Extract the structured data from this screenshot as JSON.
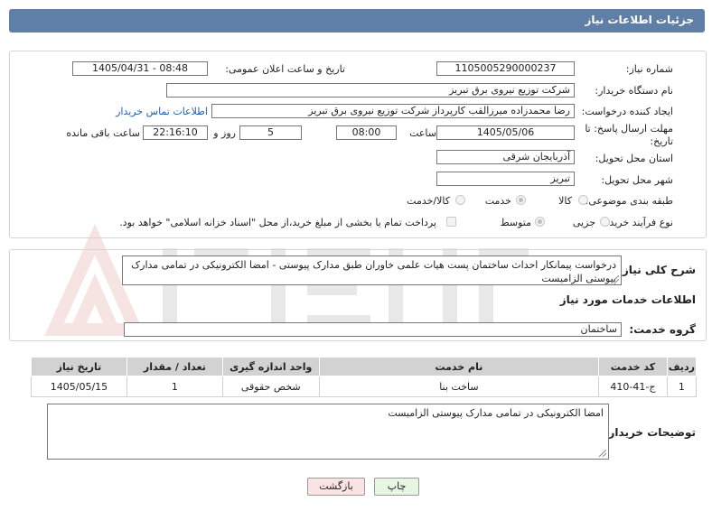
{
  "header": {
    "title": "جزئیات اطلاعات نیاز"
  },
  "need_number": {
    "label": "شماره نیاز:",
    "value": "1105005290000237"
  },
  "announce_datetime": {
    "label": "تاریخ و ساعت اعلان عمومی:",
    "value": "1405/04/31 - 08:48"
  },
  "buyer_org": {
    "label": "نام دستگاه خریدار:",
    "value": "شرکت توزیع نیروی برق تبریز"
  },
  "creator": {
    "label": "ایجاد کننده درخواست:",
    "value": "رضا محمدزاده میرزالقب کارپرداز شرکت توزیع نیروی برق تبریز",
    "contact_link": "اطلاعات تماس خریدار"
  },
  "deadline": {
    "label_line1": "مهلت ارسال پاسخ: تا",
    "label_line2": "تاریخ:",
    "date": "1405/05/06",
    "time_label": "ساعت",
    "time": "08:00",
    "days": "5",
    "days_label": "روز و",
    "remaining_time": "22:16:10",
    "remaining_label": "ساعت باقی مانده"
  },
  "province": {
    "label": "استان محل تحویل:",
    "value": "آذربایجان شرقی"
  },
  "city": {
    "label": "شهر محل تحویل:",
    "value": "تبریز"
  },
  "category": {
    "label": "طبقه بندی موضوعی:",
    "options": [
      "کالا",
      "خدمت",
      "کالا/خدمت"
    ],
    "selected": "خدمت"
  },
  "purchase_type": {
    "label": "نوع فرآیند خرید :",
    "options": [
      "جزیی",
      "متوسط"
    ],
    "selected": "متوسط",
    "payment_note": "پرداخت تمام یا بخشی از مبلغ خرید،از محل \"اسناد خزانه اسلامی\" خواهد بود."
  },
  "description": {
    "label": "شرح کلی نیاز:",
    "value": "درخواست پیمانکار احداث ساختمان پست هیات علمی خاوران طبق مدارک پیوستی - امضا الکترونیکی در تمامی مدارک پیوستی الزامیست"
  },
  "services_section": {
    "title": "اطلاعات خدمات مورد نیاز"
  },
  "service_group": {
    "label": "گروه خدمت:",
    "value": "ساختمان"
  },
  "table": {
    "headers": [
      "ردیف",
      "کد خدمت",
      "نام خدمت",
      "واحد اندازه گیری",
      "تعداد / مقدار",
      "تاریخ نیاز"
    ],
    "rows": [
      [
        "1",
        "ج-41-410",
        "ساخت بنا",
        "شخص حقوقی",
        "1",
        "1405/05/15"
      ]
    ]
  },
  "buyer_notes": {
    "label": "توضیحات خریدار:",
    "value": "امضا الکترونیکی در تمامی مدارک پیوستی الزامیست"
  },
  "buttons": {
    "print": "چاپ",
    "back": "بازگشت"
  },
  "colors": {
    "header": "#5f7fa7",
    "link": "#2262a8",
    "back_button": "#fbe3e3",
    "print_button": "#e7f6e2"
  }
}
